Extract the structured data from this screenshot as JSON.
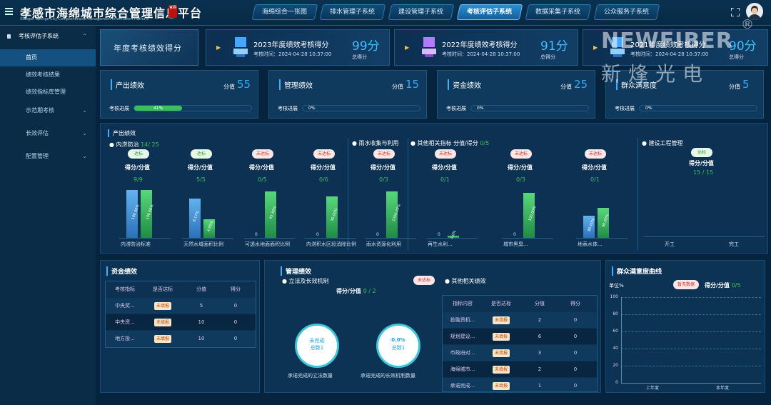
{
  "header": {
    "title": "孝感市海绵城市综合管理信息平台",
    "subtitle": "Xiaogan Sponge City Comprehensive Management Information Platform",
    "seal": "官网",
    "tabs": [
      "海绵综合一张图",
      "排水管理子系统",
      "建设管理子系统",
      "考核评估子系统",
      "数据采集子系统",
      "公众服务子系统"
    ],
    "active_tab": "考核评估子系统"
  },
  "sidebar": {
    "group": "考核评估子系统",
    "items": [
      "首页",
      "绩效考核结果",
      "绩效指标库管理",
      "示范期考核",
      "长效评估",
      "配置管理"
    ]
  },
  "banner": {
    "text": "年度考核绩效得分"
  },
  "score_cards": [
    {
      "title": "2023年度绩效考核得分",
      "time_label": "考核时间：",
      "time": "2024-04-28 10:37:00",
      "score": "99分",
      "score_label": "总得分"
    },
    {
      "title": "2022年度绩效考核得分",
      "time_label": "考核时间：",
      "time": "2024-04-28 10:37:00",
      "score": "91分",
      "score_label": "总得分"
    },
    {
      "title": "2021年度绩效考核得分",
      "time_label": "考核时间：",
      "time": "2024-04-28 10:37:00",
      "score": "90分",
      "score_label": "总得分"
    }
  ],
  "perf_cards": [
    {
      "title": "产出绩效",
      "score_label": "分值",
      "score": "55",
      "progress_label": "考核进展",
      "progress_text": "41%",
      "progress": 0.41
    },
    {
      "title": "管理绩效",
      "score_label": "分值",
      "score": "15",
      "progress_label": "考核进展",
      "progress_text": "0%",
      "progress": 0
    },
    {
      "title": "资金绩效",
      "score_label": "分值",
      "score": "25",
      "progress_label": "考核进展",
      "progress_text": "0%",
      "progress": 0
    },
    {
      "title": "群众满意度",
      "score_label": "分值",
      "score": "5",
      "progress_label": "考核进展",
      "progress_text": "0%",
      "progress": 0
    }
  ],
  "output": {
    "title": "产出绩效",
    "sub1": "内涝防治",
    "sub1_score": "14/ 25",
    "sub2": "雨水收集与利用",
    "sub3": "其他相关指标",
    "sub3_score_label": "分值/得分",
    "sub3_score": "0/5",
    "sub4": "建设工程管理",
    "score_label": "得分/分值",
    "groups": [
      {
        "badge": "达标",
        "ok": true,
        "score": "9/9",
        "bars": [
          {
            "v": "100.00%",
            "h": 0.67
          },
          {
            "v": "100.00%",
            "h": 0.67
          }
        ],
        "cat": "内涝防治标准"
      },
      {
        "badge": "达标",
        "ok": true,
        "score": "5/5",
        "bars": [
          {
            "v": "8.17%",
            "h": 0.55
          },
          {
            "v": "4.95%",
            "h": 0.26
          }
        ],
        "cat": "天然水域面积比例"
      },
      {
        "badge": "未达标",
        "ok": false,
        "score": "0/5",
        "bars": [
          {
            "v": "0",
            "h": 0
          },
          {
            "v": "45.30%",
            "h": 0.65
          }
        ],
        "cat": "可透水地面面积比例"
      },
      {
        "badge": "未达标",
        "ok": false,
        "score": "0/6",
        "bars": [
          {
            "v": "0",
            "h": 0
          },
          {
            "v": "36.00%",
            "h": 0.58
          }
        ],
        "cat": "内涝积水区段消除比例"
      },
      {
        "badge": "未达标",
        "ok": false,
        "score": "0/3",
        "bars": [
          {
            "v": "0",
            "h": 0
          },
          {
            "v": "1200.00%",
            "h": 0.65
          }
        ],
        "cat": "雨水资源化利用"
      },
      {
        "badge": "未达标",
        "ok": false,
        "score": "0/1",
        "bars": [
          {
            "v": "0",
            "h": 0
          },
          {
            "v": "0.0%",
            "h": 0.03
          }
        ],
        "cat": "再生水利..."
      },
      {
        "badge": "未达标",
        "ok": false,
        "score": "0/3",
        "bars": [
          {
            "v": "0",
            "h": 0
          },
          {
            "v": "100.00%",
            "h": 0.63
          }
        ],
        "cat": "城市黑臭..."
      },
      {
        "badge": "未达标",
        "ok": false,
        "score": "0/1",
        "bars": [
          {
            "v": "80.00%",
            "h": 0.31
          },
          {
            "v": "90.00%",
            "h": 0.42
          }
        ],
        "cat": "地表水体..."
      }
    ],
    "build": {
      "badge": "达标",
      "score_label": "得分/分值",
      "score": "15 / 15",
      "cats": [
        "开工",
        "完工"
      ]
    }
  },
  "fund": {
    "title": "资金绩效",
    "headers": [
      "考核指标",
      "是否达标",
      "分值",
      "得分"
    ],
    "rows": [
      [
        "中央奖...",
        "未填报",
        "5",
        "0"
      ],
      [
        "中央资...",
        "未填报",
        "10",
        "0"
      ],
      [
        "地方投...",
        "未填报",
        "10",
        "0"
      ]
    ]
  },
  "manage": {
    "title": "管理绩效",
    "sub1": "立法及长效机制",
    "badge": "未达标",
    "score_label": "得分/分值",
    "score": "0 / 2",
    "sub2": "其他相关绩效",
    "donuts": [
      {
        "center1": "未完成",
        "center2": "总数1",
        "label": "承诺完成的立法数量"
      },
      {
        "center1": "0.0%",
        "center2": "总数1",
        "label": "承诺完成的长效机制数量"
      }
    ],
    "headers": [
      "指标内容",
      "是否达标",
      "分值",
      "得分"
    ],
    "rows": [
      [
        "投融资机...",
        "未填报",
        "2",
        "0"
      ],
      [
        "规划建设...",
        "未填报",
        "6",
        "0"
      ],
      [
        "市政府对...",
        "未填报",
        "3",
        "0"
      ],
      [
        "海绵城市...",
        "未填报",
        "2",
        "0"
      ],
      [
        "承诺完成...",
        "未填报",
        "1",
        "0"
      ]
    ]
  },
  "satisfaction": {
    "title": "群众满意度曲线",
    "unit": "单位%",
    "badge": "暂无数据",
    "score_label": "得分/分值",
    "score": "0/5"
  },
  "chart_data": {
    "type": "line",
    "title": "群众满意度曲线",
    "ylabel": "单位%",
    "categories": [
      "上年度",
      "本年度"
    ],
    "ylim": [
      0,
      100
    ],
    "yticks": [
      0,
      20,
      40,
      60,
      80,
      100
    ],
    "series": []
  },
  "watermark": {
    "brand": "NEWFIBER",
    "cn": "新烽光电",
    "reg": "®"
  },
  "colors": {
    "accent": "#3ec0ff",
    "ok": "#39c05b",
    "bad": "#d03030"
  }
}
